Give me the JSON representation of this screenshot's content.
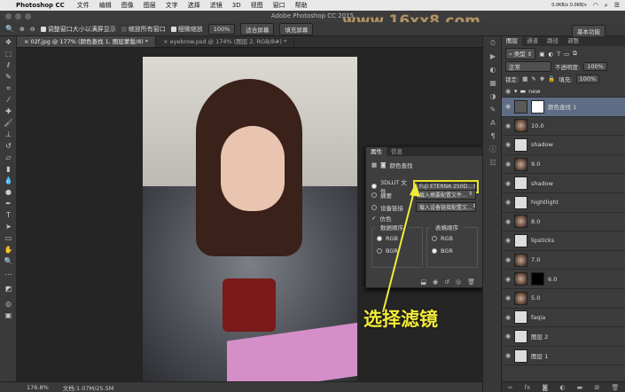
{
  "menubar": {
    "apple": "",
    "app": "Photoshop CC",
    "items": [
      "文件",
      "编辑",
      "图像",
      "图层",
      "文字",
      "选择",
      "滤镜",
      "3D",
      "视图",
      "窗口",
      "帮助"
    ],
    "net": "0.0KB/s 0.0KB/s"
  },
  "titlebar": {
    "title": "Adobe Photoshop CC 2015"
  },
  "watermark": "www.16xx8.com",
  "options": {
    "zoom_icon": "🔍",
    "cb1": "调整窗口大小以满屏显示",
    "cb2": "缩放所有窗口",
    "cb3": "细微缩放",
    "btn100": "100%",
    "btn_fit": "适合屏幕",
    "btn_fill": "填充屏幕",
    "workspace": "基本功能"
  },
  "tabs": [
    {
      "label": "02f.jpg @ 177% (颜色查找 1, 图层蒙版/8) *"
    },
    {
      "label": "eyebrow.psd @ 174% (图层 2, RGB/8#) *"
    }
  ],
  "status": {
    "zoom": "176.8%",
    "doc": "文档:1.07M/25.5M"
  },
  "layers_panel": {
    "tabs": [
      "图层",
      "通道",
      "路径",
      "调整"
    ],
    "kind": "类型",
    "blend": "正常",
    "opacity_label": "不透明度:",
    "opacity": "100%",
    "lock_label": "锁定:",
    "fill_label": "填充:",
    "fill": "100%",
    "layers": [
      {
        "name": "new",
        "type": "group"
      },
      {
        "name": "颜色查找 1",
        "type": "adj",
        "selected": true
      },
      {
        "name": "10.0",
        "type": "img"
      },
      {
        "name": "shadow",
        "type": "blank"
      },
      {
        "name": "9.0",
        "type": "img"
      },
      {
        "name": "shadow",
        "type": "blank"
      },
      {
        "name": "hightlight",
        "type": "blank"
      },
      {
        "name": "8.0",
        "type": "img"
      },
      {
        "name": "lipsticks",
        "type": "blank"
      },
      {
        "name": "7.0",
        "type": "img"
      },
      {
        "name": "6.0",
        "type": "imgmask"
      },
      {
        "name": "5.0",
        "type": "img"
      },
      {
        "name": "faqia",
        "type": "blank"
      },
      {
        "name": "图层 2",
        "type": "blank"
      },
      {
        "name": "图层 1",
        "type": "blank"
      }
    ]
  },
  "properties": {
    "tabs": [
      "属性",
      "信息"
    ],
    "title": "颜色查找",
    "lut_label": "3DLUT 文件",
    "lut_value": "Fuji ETERNA 250D...",
    "abstract_label": "摘要",
    "abstract_value": "载入摘要配置文件...",
    "devlink_label": "设备链接",
    "devlink_value": "载入设备链接配置文...",
    "dither_label": "仿色",
    "data_order": "数据顺序",
    "table_order": "表格顺序",
    "rgb": "RGB",
    "bgr": "BGR"
  },
  "annotation": "选择滤镜"
}
